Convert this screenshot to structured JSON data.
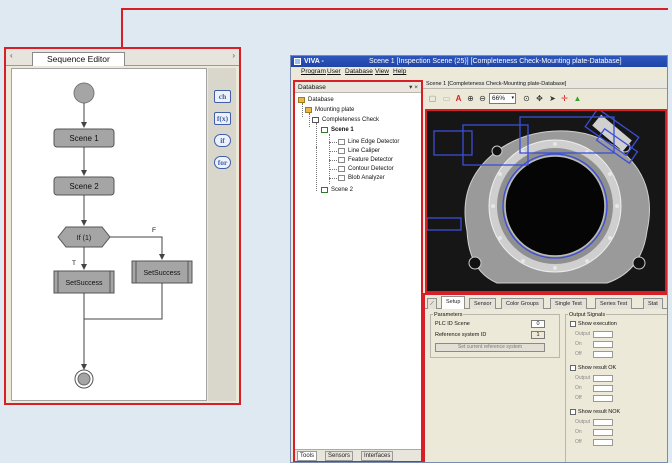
{
  "colors": {
    "highlight": "#d61f26",
    "canvas": "#dfe9f1",
    "flow_node": "#a5a5a5",
    "selection": "#3b4fd6"
  },
  "sequence_editor": {
    "tab_label": "Sequence Editor",
    "left_arrow": "‹",
    "right_arrow": "›",
    "palette": [
      {
        "icon": "ch-icon",
        "label": "ch"
      },
      {
        "icon": "fx-icon",
        "label": "f(x)"
      },
      {
        "icon": "if-icon",
        "label": "if"
      },
      {
        "icon": "for-icon",
        "label": "for"
      }
    ],
    "flow": {
      "scene1": "Scene 1",
      "scene2": "Scene 2",
      "decision": "If (1)",
      "true_label": "T",
      "false_label": "F",
      "set_success_left": "SetSuccess",
      "set_success_right": "SetSuccess"
    }
  },
  "viva": {
    "app_name": "VIVA -",
    "title": "Scene 1 [Inspection Scene (25)] [Completeness Check-Mounting plate-Database]",
    "menu": [
      "Program",
      "User",
      "Database",
      "View",
      "Help"
    ],
    "database_panel": {
      "title": "Database",
      "controls": "▾ ×",
      "tree": {
        "root": "Database",
        "plate": "Mounting plate",
        "check": "Completeness Check",
        "scene1": "Scene 1",
        "tools": [
          "Line Edge Detector",
          "Line Caliper",
          "Feature Detector",
          "Contour Detector",
          "Blob Analyzer"
        ],
        "scene2": "Scene 2"
      },
      "bottom_tabs": [
        "Tools",
        "Sensors",
        "Interfaces"
      ]
    },
    "scene_panel": {
      "header": "Scene 1 [Completeness Check-Mounting plate-Database]",
      "zoom": "66%"
    },
    "setup_panel": {
      "tabs": [
        "Setup",
        "Sensor",
        "Color Groups",
        "Single Test",
        "Series Test",
        "Stat"
      ],
      "parameters": {
        "group_title": "Parameters",
        "plc_id_label": "PLC ID Scene",
        "plc_id_value": "0",
        "ref_label": "Reference system ID",
        "ref_value": "1",
        "button": "Set current reference system"
      },
      "output": {
        "group_title": "Output Signals",
        "show_execution": "Show execution",
        "show_ok": "Show result OK",
        "show_nok": "Show result NOK",
        "out_label": "Output",
        "on_label": "On",
        "off_label": "Off"
      }
    }
  }
}
